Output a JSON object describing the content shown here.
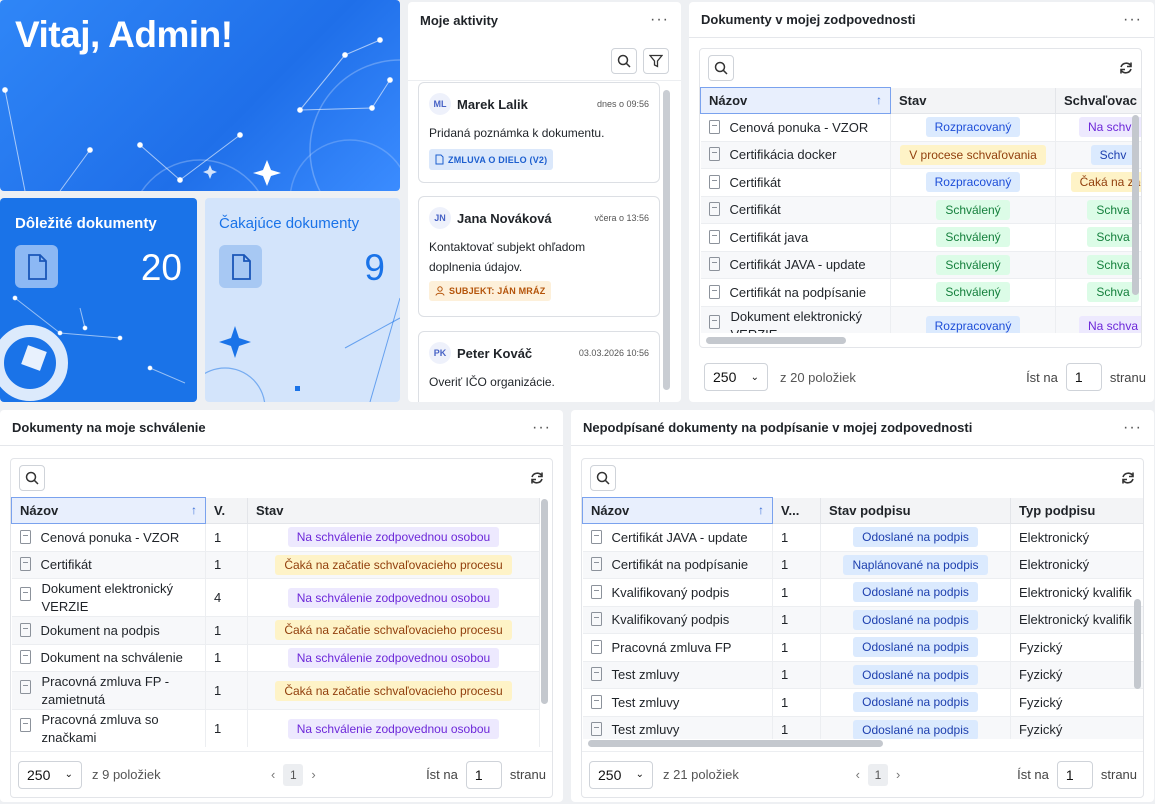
{
  "welcome": {
    "title": "Vitaj, Admin!"
  },
  "tiles": {
    "important": {
      "label": "Dôležité dokumenty",
      "count": "20"
    },
    "waiting": {
      "label": "Čakajúce dokumenty",
      "count": "9"
    }
  },
  "activities": {
    "title": "Moje aktivity",
    "items": [
      {
        "initials": "ML",
        "name": "Marek Lalik",
        "time": "dnes o 09:56",
        "text": "Pridaná poznámka k dokumentu.",
        "tag": "ZMLUVA O DIELO (V2)",
        "tag_icon": "document-icon"
      },
      {
        "initials": "JN",
        "name": "Jana Nováková",
        "time": "včera o 13:56",
        "text": "Kontaktovať subjekt ohľadom doplnenia údajov.",
        "tag": "SUBJEKT: JÁN MRÁZ",
        "tag_icon": "person-icon"
      },
      {
        "initials": "PK",
        "name": "Peter Kováč",
        "time": "03.03.2026 10:56",
        "text": "Overiť IČO organizácie."
      }
    ]
  },
  "resp_docs": {
    "title": "Dokumenty v mojej zodpovednosti",
    "columns": [
      "Názov",
      "Stav",
      "Schvaľovac"
    ],
    "rows": [
      {
        "name": "Cenová ponuka - VZOR",
        "state": "Rozpracovaný",
        "approval": "Na schva"
      },
      {
        "name": "Certifikácia docker",
        "state": "V procese schvaľovania",
        "approval": "Schv"
      },
      {
        "name": "Certifikát",
        "state": "Rozpracovaný",
        "approval": "Čaká na zač"
      },
      {
        "name": "Certifikát",
        "state": "Schválený",
        "approval": "Schva"
      },
      {
        "name": "Certifikát java",
        "state": "Schválený",
        "approval": "Schva"
      },
      {
        "name": "Certifikát JAVA - update",
        "state": "Schválený",
        "approval": "Schva"
      },
      {
        "name": "Certifikát na podpísanie",
        "state": "Schválený",
        "approval": "Schva"
      },
      {
        "name": "Dokument elektronický VERZIE",
        "state": "Rozpracovaný",
        "approval": "Na schva"
      }
    ],
    "page_size": "250",
    "total": "z 20 položiek",
    "goto_label": "Íst na",
    "goto_value": "1",
    "page_word": "stranu"
  },
  "approve_docs": {
    "title": "Dokumenty na moje schválenie",
    "columns": [
      "Názov",
      "V.",
      "Stav"
    ],
    "rows": [
      {
        "name": "Cenová ponuka - VZOR",
        "v": "1",
        "state": "Na schválenie zodpovednou osobou"
      },
      {
        "name": "Certifikát",
        "v": "1",
        "state": "Čaká na začatie schvaľovacieho procesu"
      },
      {
        "name": "Dokument elektronický VERZIE",
        "v": "4",
        "state": "Na schválenie zodpovednou osobou"
      },
      {
        "name": "Dokument na podpis",
        "v": "1",
        "state": "Čaká na začatie schvaľovacieho procesu"
      },
      {
        "name": "Dokument na schválenie",
        "v": "1",
        "state": "Na schválenie zodpovednou osobou"
      },
      {
        "name": "Pracovná zmluva FP - zamietnutá",
        "v": "1",
        "state": "Čaká na začatie schvaľovacieho procesu"
      },
      {
        "name": "Pracovná zmluva so značkami",
        "v": "1",
        "state": "Na schválenie zodpovednou osobou"
      }
    ],
    "page_size": "250",
    "total": "z 9 položiek",
    "page": "1",
    "goto_label": "Íst na",
    "goto_value": "1",
    "page_word": "stranu"
  },
  "unsigned_docs": {
    "title": "Nepodpísané dokumenty na podpísanie v mojej zodpovednosti",
    "columns": [
      "Názov",
      "V...",
      "Stav podpisu",
      "Typ podpisu"
    ],
    "rows": [
      {
        "name": "Certifikát JAVA - update",
        "v": "1",
        "state": "Odoslané na podpis",
        "type": "Elektronický"
      },
      {
        "name": "Certifikát na podpísanie",
        "v": "1",
        "state": "Naplánované na podpis",
        "type": "Elektronický"
      },
      {
        "name": "Kvalifikovaný podpis",
        "v": "1",
        "state": "Odoslané na podpis",
        "type": "Elektronický kvalifik"
      },
      {
        "name": "Kvalifikovaný podpis",
        "v": "1",
        "state": "Odoslané na podpis",
        "type": "Elektronický kvalifik"
      },
      {
        "name": "Pracovná zmluva FP",
        "v": "1",
        "state": "Odoslané na podpis",
        "type": "Fyzický"
      },
      {
        "name": "Test zmluvy",
        "v": "1",
        "state": "Odoslané na podpis",
        "type": "Fyzický"
      },
      {
        "name": "Test zmluvy",
        "v": "1",
        "state": "Odoslané na podpis",
        "type": "Fyzický"
      },
      {
        "name": "Test zmluvy",
        "v": "1",
        "state": "Odoslané na podpis",
        "type": "Fyzický"
      }
    ],
    "page_size": "250",
    "total": "z 21 položiek",
    "page": "1",
    "goto_label": "Íst na",
    "goto_value": "1",
    "page_word": "stranu"
  },
  "colors": {
    "accent": "#1a73e8",
    "tile_light": "#d3e4fb"
  }
}
